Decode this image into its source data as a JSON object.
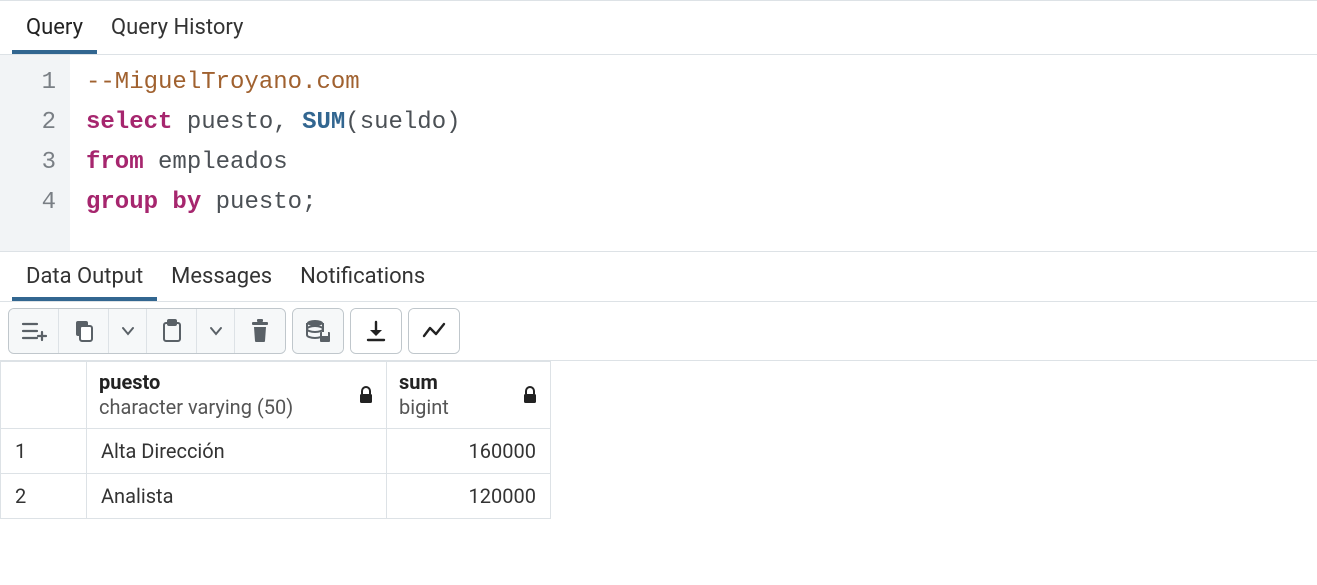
{
  "editor_tabs": [
    {
      "label": "Query",
      "active": true
    },
    {
      "label": "Query History",
      "active": false
    }
  ],
  "sql": {
    "lines": [
      {
        "n": 1,
        "tokens": [
          {
            "t": "--MiguelTroyano.com",
            "c": "comment"
          }
        ]
      },
      {
        "n": 2,
        "tokens": [
          {
            "t": "select",
            "c": "keyword"
          },
          {
            "t": " ",
            "c": "ident"
          },
          {
            "t": "puesto",
            "c": "ident"
          },
          {
            "t": ",",
            "c": "punct"
          },
          {
            "t": " ",
            "c": "ident"
          },
          {
            "t": "SUM",
            "c": "func"
          },
          {
            "t": "(",
            "c": "punct"
          },
          {
            "t": "sueldo",
            "c": "ident"
          },
          {
            "t": ")",
            "c": "punct"
          }
        ]
      },
      {
        "n": 3,
        "tokens": [
          {
            "t": "from",
            "c": "keyword"
          },
          {
            "t": " ",
            "c": "ident"
          },
          {
            "t": "empleados",
            "c": "ident"
          }
        ]
      },
      {
        "n": 4,
        "tokens": [
          {
            "t": "group",
            "c": "keyword"
          },
          {
            "t": " ",
            "c": "ident"
          },
          {
            "t": "by",
            "c": "keyword"
          },
          {
            "t": " ",
            "c": "ident"
          },
          {
            "t": "puesto",
            "c": "ident"
          },
          {
            "t": ";",
            "c": "punct"
          }
        ]
      }
    ]
  },
  "output_tabs": [
    {
      "label": "Data Output",
      "active": true
    },
    {
      "label": "Messages",
      "active": false
    },
    {
      "label": "Notifications",
      "active": false
    }
  ],
  "toolbar": {
    "buttons": [
      "add-row",
      "copy",
      "copy-dropdown",
      "paste",
      "paste-dropdown",
      "delete",
      "save-data",
      "download",
      "graph"
    ]
  },
  "results": {
    "columns": [
      {
        "name": "puesto",
        "type": "character varying (50)",
        "locked": true,
        "align": "left"
      },
      {
        "name": "sum",
        "type": "bigint",
        "locked": true,
        "align": "right"
      }
    ],
    "rows": [
      {
        "n": 1,
        "cells": [
          "Alta Dirección",
          "160000"
        ]
      },
      {
        "n": 2,
        "cells": [
          "Analista",
          "120000"
        ]
      }
    ]
  }
}
